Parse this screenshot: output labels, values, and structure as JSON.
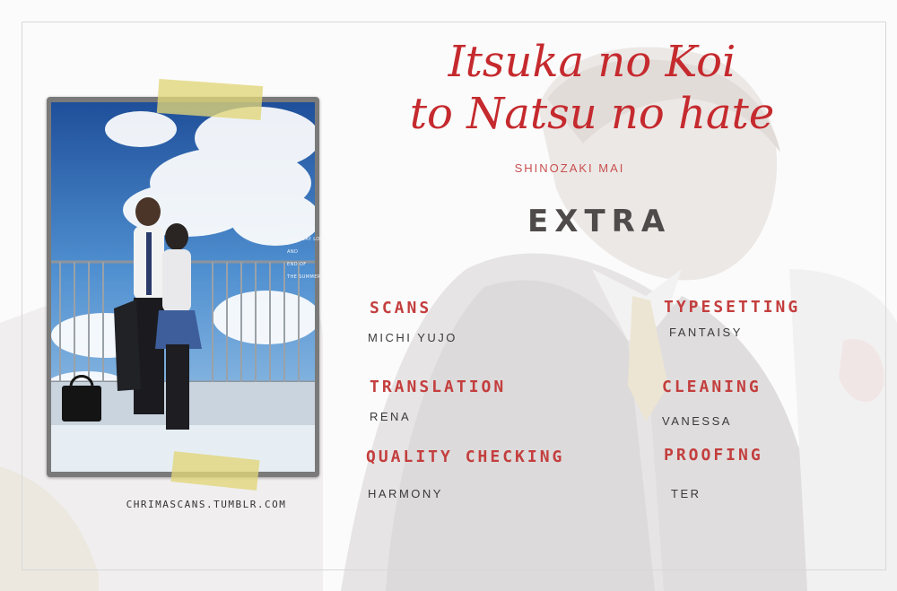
{
  "cover": {
    "text_lines": [
      "SHI MAI",
      "SOMEDAY LOVE",
      "AND",
      "END OF",
      "THE SUMMER"
    ]
  },
  "title": {
    "line1": "Itsuka no Koi",
    "line2": "to Natsu no hate"
  },
  "author": "SHINOZAKI MAI",
  "chapter_label": "EXTRA",
  "credits": [
    {
      "role": "SCANS",
      "name": "MICHI YUJO"
    },
    {
      "role": "TYPESETTING",
      "name": "FANTAISY"
    },
    {
      "role": "TRANSLATION",
      "name": "RENA"
    },
    {
      "role": "CLEANING",
      "name": "VANESSA"
    },
    {
      "role": "QUALITY CHECKING",
      "name": "HARMONY"
    },
    {
      "role": "PROOFING",
      "name": "TER"
    }
  ],
  "site_url": "CHRIMASCANS.TUMBLR.COM",
  "colors": {
    "title": "#c52a2e",
    "role": "#c43e3e",
    "text": "#3a3a3a",
    "frame": "#d8d8d8"
  }
}
